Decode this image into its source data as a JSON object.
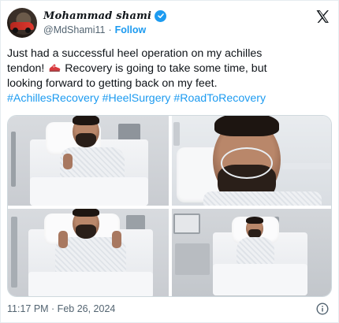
{
  "author": {
    "display_name": "Mohammad shami",
    "handle": "@MdShami11",
    "separator": "·",
    "follow_label": "Follow"
  },
  "tweet": {
    "line1": "Just had a successful heel operation on my achilles",
    "line2a": "tendon!",
    "line2b": "Recovery is going to take some time, but",
    "line3": "looking forward to getting back on my feet.",
    "hashtags": [
      "#AchillesRecovery",
      "#HeelSurgery",
      "#RoadToRecovery"
    ],
    "emoji": "running-shoe"
  },
  "footer": {
    "timestamp": "11:17 PM · Feb 26, 2024"
  },
  "icons": {
    "verified": "verified-badge-icon",
    "brand": "x-logo-icon",
    "info": "info-icon"
  },
  "colors": {
    "link": "#1d9bf0",
    "text": "#0f1419",
    "secondary": "#536471",
    "border": "#cfd9de"
  }
}
